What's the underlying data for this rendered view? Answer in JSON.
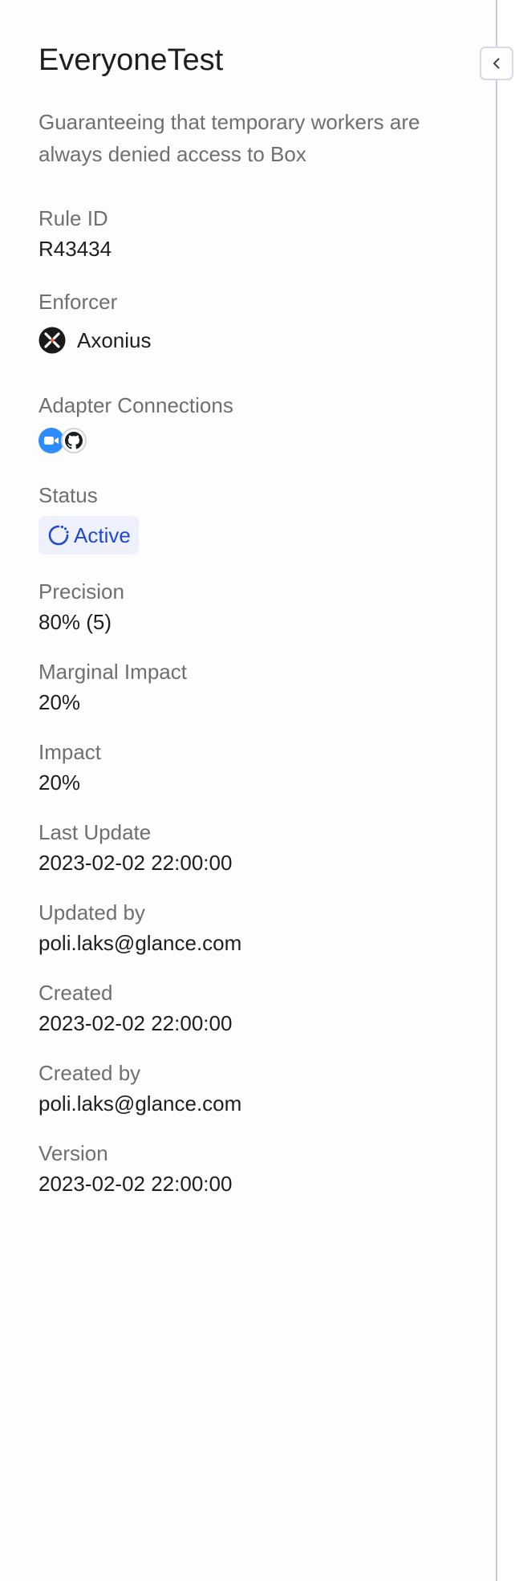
{
  "panel": {
    "title": "EveryoneTest",
    "description": "Guaranteeing that temporary workers are always denied access to Box"
  },
  "fields": {
    "rule_id": {
      "label": "Rule ID",
      "value": "R43434"
    },
    "enforcer": {
      "label": "Enforcer",
      "value": "Axonius",
      "icon": "axonius-logo-icon"
    },
    "adapters": {
      "label": "Adapter Connections",
      "items": [
        "zoom-icon",
        "github-icon"
      ]
    },
    "status": {
      "label": "Status",
      "value": "Active",
      "icon": "spinner-icon",
      "color": "#1f49d4"
    },
    "precision": {
      "label": "Precision",
      "value": "80% (5)"
    },
    "marginal_impact": {
      "label": "Marginal Impact",
      "value": "20%"
    },
    "impact": {
      "label": "Impact",
      "value": "20%"
    },
    "last_update": {
      "label": "Last Update",
      "value": "2023-02-02 22:00:00"
    },
    "updated_by": {
      "label": "Updated by",
      "value": "poli.laks@glance.com"
    },
    "created": {
      "label": "Created",
      "value": "2023-02-02 22:00:00"
    },
    "created_by": {
      "label": "Created by",
      "value": "poli.laks@glance.com"
    },
    "version": {
      "label": "Version",
      "value": "2023-02-02 22:00:00"
    }
  },
  "colors": {
    "divider": "#c8cbe6",
    "status_bg": "#eef1fb",
    "zoom": "#2d8cff"
  }
}
